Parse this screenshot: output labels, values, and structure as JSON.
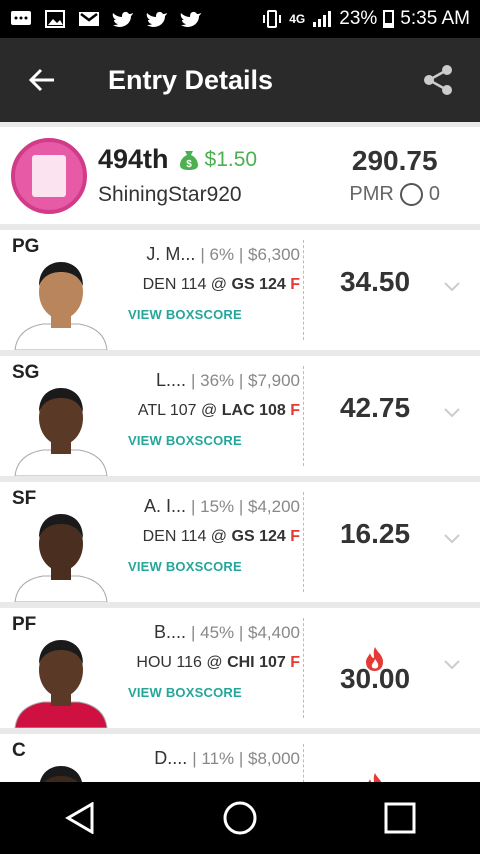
{
  "status_bar": {
    "battery": "23%",
    "time": "5:35 AM",
    "network": "4G"
  },
  "app_bar": {
    "title": "Entry Details"
  },
  "summary": {
    "rank": "494th",
    "winnings": "$1.50",
    "username": "ShiningStar920",
    "total_points": "290.75",
    "pmr_label": "PMR",
    "pmr_value": "0"
  },
  "players": [
    {
      "pos": "PG",
      "name": "J. M...",
      "meta": "| 6% | $6,300",
      "away": "DEN 114",
      "at": "@",
      "home": "GS 124",
      "flag": "F",
      "boxscore": "VIEW BOXSCORE",
      "points": "34.50",
      "hot": false,
      "jersey_color": "#ffffff",
      "skin": "#b9855c"
    },
    {
      "pos": "SG",
      "name": "L....",
      "meta": "| 36% | $7,900",
      "away": "ATL 107",
      "at": "@",
      "home": "LAC 108",
      "flag": "F",
      "boxscore": "VIEW BOXSCORE",
      "points": "42.75",
      "hot": false,
      "jersey_color": "#ffffff",
      "skin": "#5a3a26"
    },
    {
      "pos": "SF",
      "name": "A. I...",
      "meta": "| 15% | $4,200",
      "away": "DEN 114",
      "at": "@",
      "home": "GS 124",
      "flag": "F",
      "boxscore": "VIEW BOXSCORE",
      "points": "16.25",
      "hot": false,
      "jersey_color": "#ffffff",
      "skin": "#4a2f20"
    },
    {
      "pos": "PF",
      "name": "B....",
      "meta": "| 45% | $4,400",
      "away": "HOU 116",
      "at": "@",
      "home": "CHI 107",
      "flag": "F",
      "boxscore": "VIEW BOXSCORE",
      "points": "30.00",
      "hot": true,
      "jersey_color": "#ce1141",
      "skin": "#5a3a26"
    },
    {
      "pos": "C",
      "name": "D....",
      "meta": "| 11% | $8,000",
      "away": "",
      "at": "",
      "home": "",
      "flag": "",
      "boxscore": "",
      "points": "",
      "hot": true,
      "jersey_color": "#ffffff",
      "skin": "#3d281c"
    }
  ],
  "colors": {
    "accent_green": "#4caf50",
    "boxscore_teal": "#26a69a",
    "flag_red": "#e53935",
    "fire_red": "#e53935"
  }
}
